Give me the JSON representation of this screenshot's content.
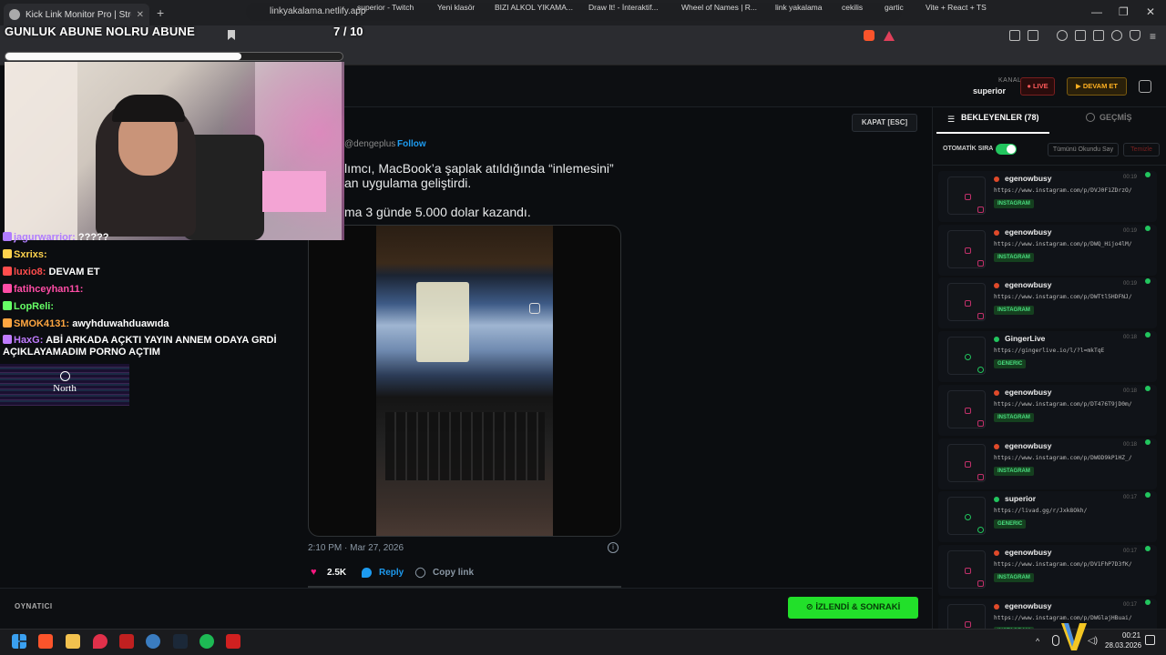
{
  "browser": {
    "tab_title": "Kick Link Monitor Pro | Stream",
    "new_tab": "+",
    "url": "linkyakalama.netlify.app",
    "window_controls": [
      "—",
      "❐",
      "✕"
    ],
    "bookmarks": [
      "superior - Twitch",
      "Yeni klasör",
      "BIZI ALKOL YIKAMA...",
      "Draw It! - İnteraktif...",
      "Wheel of Names | R...",
      "link yakalama",
      "cekilis",
      "gartic",
      "Vite + React + TS"
    ]
  },
  "overlay": {
    "title": "GUNLUK ABUNE NOLRU ABUNE",
    "count": "7 / 10",
    "progress": 0.7
  },
  "chat": [
    {
      "user": "jagurwarrior:",
      "msg": "?????",
      "color": "#b07cff"
    },
    {
      "user": "Sxrixs:",
      "msg": "",
      "color": "#ffd34d"
    },
    {
      "user": "luxio8:",
      "msg": "DEVAM ET",
      "color": "#ff4d4d"
    },
    {
      "user": "fatihceyhan11:",
      "msg": "",
      "color": "#ff4da6"
    },
    {
      "user": "LopReli:",
      "msg": "",
      "color": "#66ff66"
    },
    {
      "user": "SMOK4131:",
      "msg": "awyhduwahduawıda",
      "color": "#ffa640"
    },
    {
      "user": "HaxG:",
      "msg": "ABİ ARKADA AÇKTI YAYIN ANNEM ODAYA GRDİ AÇIKLAYAMADIM PORNO AÇTIM",
      "color": "#c07cff"
    }
  ],
  "north_label": "North",
  "header": {
    "kanal_label": "KANAL",
    "kanal_value": "superior",
    "live_label": "● LIVE",
    "devam_label": "▶ DEVAM ET"
  },
  "viewer": {
    "close_label": "KAPAT [ESC]",
    "tweet_handle": "@dengeplus ·",
    "tweet_follow": "Follow",
    "tweet_lines": [
      "lımcı, MacBook’a şaplak atıldığında “inlemesini”",
      "an uygulama geliştirdi.",
      "ma 3 günde 5.000 dolar kazandı."
    ],
    "tweet_time": "2:10 PM · Mar 27, 2026",
    "likes": "2.5K",
    "reply": "Reply",
    "copy_link": "Copy link"
  },
  "sidebar": {
    "tab_queue": "BEKLEYENLER (78)",
    "tab_history": "GEÇMİŞ",
    "auto_label": "OTOMATİK SIRA",
    "auto_on": true,
    "mark_all": "Tümünü Okundu Say",
    "clear": "Temizle",
    "items": [
      {
        "user": "egenowbusy",
        "time": "00:19",
        "url": "https://www.instagram.com/p/DVJ0F1ZDrzO/",
        "tag": "INSTAGRAM",
        "platform": "instagram"
      },
      {
        "user": "egenowbusy",
        "time": "00:19",
        "url": "https://www.instagram.com/p/DWQ_Hijo4lM/",
        "tag": "INSTAGRAM",
        "platform": "instagram"
      },
      {
        "user": "egenowbusy",
        "time": "00:19",
        "url": "https://www.instagram.com/p/DWTtl5HDFNJ/",
        "tag": "INSTAGRAM",
        "platform": "instagram"
      },
      {
        "user": "GingerLive",
        "time": "00:18",
        "url": "https://gingerlive.io/l/?l=mkTqE",
        "tag": "GENERIC",
        "platform": "generic"
      },
      {
        "user": "egenowbusy",
        "time": "00:18",
        "url": "https://www.instagram.com/p/DT476T9jD0m/",
        "tag": "INSTAGRAM",
        "platform": "instagram"
      },
      {
        "user": "egenowbusy",
        "time": "00:18",
        "url": "https://www.instagram.com/p/DWOD9kP1HZ_/",
        "tag": "INSTAGRAM",
        "platform": "instagram"
      },
      {
        "user": "superior",
        "time": "00:17",
        "url": "https://livad.gg/r/Jxk8Okh/",
        "tag": "GENERIC",
        "platform": "generic"
      },
      {
        "user": "egenowbusy",
        "time": "00:17",
        "url": "https://www.instagram.com/p/DV1FhP7D3fK/",
        "tag": "INSTAGRAM",
        "platform": "instagram"
      },
      {
        "user": "egenowbusy",
        "time": "00:17",
        "url": "https://www.instagram.com/p/DWGlajHBuai/",
        "tag": "INSTAGRAM",
        "platform": "instagram"
      }
    ]
  },
  "footer": {
    "player_label": "OYNATICI",
    "watched_label": "⊘ İZLENDİ & SONRAKİ"
  },
  "taskbar": {
    "time": "00:21",
    "date": "28.03.2026"
  },
  "colors": {
    "accent_green": "#22e02a",
    "live_red": "#ff5a5a",
    "devam_orange": "#ffb020",
    "instagram_pink": "#c0306a"
  }
}
